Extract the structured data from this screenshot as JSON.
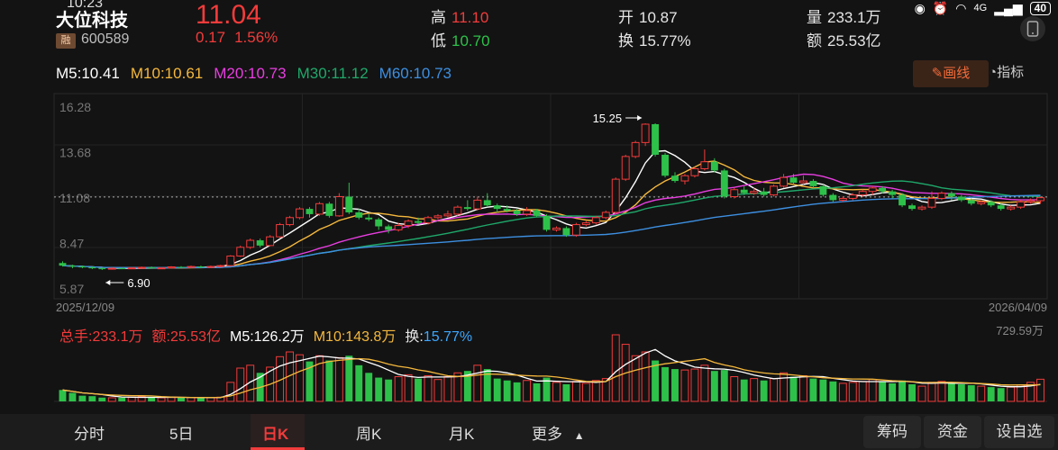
{
  "status": {
    "time": "10:23",
    "battery": "40",
    "network": "4G"
  },
  "stock": {
    "name": "大位科技",
    "tag": "融",
    "code": "600589",
    "price": "11.04",
    "change": "0.17",
    "change_pct": "1.56%"
  },
  "quote": {
    "high_label": "高",
    "high": "11.10",
    "low_label": "低",
    "low": "10.70",
    "open_label": "开",
    "open": "10.87",
    "turnover_label": "换",
    "turnover": "15.77%",
    "volume_label": "量",
    "volume": "233.1万",
    "amount_label": "额",
    "amount": "25.53亿"
  },
  "ma": {
    "m5": "M5:10.41",
    "m10": "M10:10.61",
    "m20": "M20:10.73",
    "m30": "M30:11.12",
    "m60": "M60:10.73",
    "colors": {
      "m5": "#ffffff",
      "m10": "#f5b83d",
      "m20": "#e83ee0",
      "m30": "#1fa86a",
      "m60": "#3d8fe0"
    }
  },
  "toolbar": {
    "draw_label": "画线",
    "indicator_label": "指标"
  },
  "chart_data": {
    "type": "candlestick",
    "y_ticks": [
      "16.28",
      "13.68",
      "11.08",
      "8.47",
      "5.87"
    ],
    "ylim": [
      5.87,
      16.28
    ],
    "start_date": "2025/12/09",
    "end_date": "2026/04/09",
    "max_label": "15.25",
    "min_label": "6.90",
    "current_price": 11.08,
    "candles": [
      [
        7.3,
        7.15,
        7.4,
        7.1
      ],
      [
        7.15,
        7.1,
        7.2,
        7.0
      ],
      [
        7.1,
        7.05,
        7.15,
        7.0
      ],
      [
        7.05,
        7.0,
        7.1,
        6.95
      ],
      [
        7.0,
        6.95,
        7.05,
        6.9
      ],
      [
        6.95,
        7.0,
        7.05,
        6.92
      ],
      [
        7.0,
        6.98,
        7.05,
        6.95
      ],
      [
        6.98,
        7.02,
        7.05,
        6.95
      ],
      [
        7.02,
        7.05,
        7.1,
        7.0
      ],
      [
        7.05,
        7.0,
        7.1,
        6.98
      ],
      [
        7.0,
        7.02,
        7.05,
        6.98
      ],
      [
        7.02,
        7.08,
        7.12,
        7.0
      ],
      [
        7.08,
        7.05,
        7.12,
        7.02
      ],
      [
        7.05,
        7.1,
        7.15,
        7.02
      ],
      [
        7.1,
        7.05,
        7.15,
        7.02
      ],
      [
        7.05,
        7.1,
        7.15,
        7.02
      ],
      [
        7.1,
        7.15,
        7.2,
        7.05
      ],
      [
        7.15,
        7.7,
        7.75,
        7.1
      ],
      [
        7.7,
        8.2,
        8.3,
        7.65
      ],
      [
        8.2,
        8.6,
        8.7,
        8.1
      ],
      [
        8.6,
        8.3,
        8.7,
        8.2
      ],
      [
        8.3,
        8.8,
        8.9,
        8.25
      ],
      [
        8.8,
        9.5,
        9.6,
        8.7
      ],
      [
        9.5,
        9.9,
        10.0,
        9.4
      ],
      [
        9.9,
        10.4,
        10.5,
        9.8
      ],
      [
        10.4,
        10.1,
        10.5,
        9.9
      ],
      [
        10.1,
        10.7,
        10.8,
        10.0
      ],
      [
        10.7,
        10.0,
        10.8,
        9.9
      ],
      [
        10.0,
        11.1,
        11.3,
        9.95
      ],
      [
        11.1,
        10.2,
        11.9,
        10.1
      ],
      [
        10.2,
        9.9,
        10.4,
        9.8
      ],
      [
        9.9,
        9.8,
        10.1,
        9.7
      ],
      [
        9.8,
        9.4,
        9.9,
        9.2
      ],
      [
        9.4,
        9.2,
        9.5,
        9.0
      ],
      [
        9.2,
        9.45,
        9.6,
        9.1
      ],
      [
        9.45,
        9.7,
        9.8,
        9.3
      ],
      [
        9.7,
        9.6,
        9.9,
        9.5
      ],
      [
        9.6,
        9.9,
        10.0,
        9.5
      ],
      [
        9.9,
        10.0,
        10.1,
        9.8
      ],
      [
        10.0,
        10.1,
        10.3,
        9.9
      ],
      [
        10.1,
        10.5,
        10.6,
        10.0
      ],
      [
        10.5,
        10.4,
        10.9,
        10.3
      ],
      [
        10.4,
        10.9,
        11.1,
        10.3
      ],
      [
        10.9,
        10.6,
        11.3,
        10.5
      ],
      [
        10.6,
        10.4,
        10.7,
        10.2
      ],
      [
        10.4,
        10.3,
        10.6,
        10.2
      ],
      [
        10.3,
        10.1,
        10.4,
        10.0
      ],
      [
        10.1,
        10.3,
        10.5,
        10.0
      ],
      [
        10.3,
        10.0,
        10.4,
        9.95
      ],
      [
        10.0,
        9.2,
        10.1,
        9.1
      ],
      [
        9.2,
        9.3,
        9.4,
        9.1
      ],
      [
        9.3,
        8.9,
        9.4,
        8.8
      ],
      [
        8.9,
        9.5,
        9.6,
        8.8
      ],
      [
        9.5,
        9.6,
        9.7,
        9.4
      ],
      [
        9.6,
        9.9,
        10.0,
        9.5
      ],
      [
        9.9,
        10.2,
        10.3,
        9.8
      ],
      [
        10.2,
        12.1,
        12.2,
        10.1
      ],
      [
        12.1,
        13.4,
        13.5,
        12.0
      ],
      [
        13.4,
        14.2,
        14.3,
        13.3
      ],
      [
        14.2,
        15.25,
        15.3,
        14.0
      ],
      [
        15.25,
        13.5,
        15.3,
        13.4
      ],
      [
        13.5,
        12.3,
        13.6,
        12.2
      ],
      [
        12.3,
        12.0,
        12.5,
        11.9
      ],
      [
        12.0,
        12.3,
        12.4,
        11.8
      ],
      [
        12.3,
        12.7,
        12.8,
        12.2
      ],
      [
        12.7,
        13.1,
        13.8,
        12.6
      ],
      [
        13.1,
        12.6,
        13.3,
        12.5
      ],
      [
        12.6,
        11.1,
        12.7,
        11.0
      ],
      [
        11.1,
        11.5,
        11.6,
        11.0
      ],
      [
        11.5,
        11.3,
        11.7,
        11.2
      ],
      [
        11.3,
        11.4,
        11.6,
        11.2
      ],
      [
        11.4,
        11.2,
        11.6,
        11.1
      ],
      [
        11.2,
        11.7,
        11.8,
        11.1
      ],
      [
        11.7,
        12.2,
        12.4,
        11.6
      ],
      [
        12.2,
        11.9,
        12.4,
        11.8
      ],
      [
        11.9,
        12.0,
        12.3,
        11.8
      ],
      [
        12.0,
        11.7,
        12.1,
        11.6
      ],
      [
        11.7,
        11.2,
        11.8,
        11.1
      ],
      [
        11.2,
        10.9,
        11.3,
        10.8
      ],
      [
        10.9,
        11.0,
        11.1,
        10.8
      ],
      [
        11.0,
        11.2,
        11.3,
        10.9
      ],
      [
        11.2,
        11.4,
        11.5,
        11.1
      ],
      [
        11.4,
        11.6,
        11.7,
        11.2
      ],
      [
        11.6,
        11.4,
        11.7,
        11.3
      ],
      [
        11.4,
        11.2,
        11.5,
        11.0
      ],
      [
        11.2,
        10.6,
        11.3,
        10.5
      ],
      [
        10.6,
        10.4,
        10.7,
        10.3
      ],
      [
        10.4,
        10.5,
        10.6,
        10.3
      ],
      [
        10.5,
        11.0,
        11.4,
        10.4
      ],
      [
        11.0,
        11.3,
        11.4,
        10.9
      ],
      [
        11.3,
        11.1,
        11.4,
        10.9
      ],
      [
        11.1,
        10.9,
        11.2,
        10.8
      ],
      [
        10.9,
        10.7,
        11.0,
        10.6
      ],
      [
        10.7,
        10.8,
        10.9,
        10.6
      ],
      [
        10.8,
        10.6,
        10.9,
        10.5
      ],
      [
        10.6,
        10.4,
        10.7,
        10.3
      ],
      [
        10.4,
        10.5,
        10.6,
        10.3
      ],
      [
        10.5,
        10.8,
        10.9,
        10.4
      ],
      [
        10.8,
        10.87,
        11.0,
        10.7
      ],
      [
        10.87,
        11.04,
        11.1,
        10.7
      ]
    ],
    "volume_max_label": "729.59万",
    "volumes": [
      120,
      90,
      60,
      55,
      40,
      38,
      40,
      45,
      50,
      42,
      38,
      45,
      40,
      42,
      38,
      40,
      45,
      200,
      350,
      380,
      300,
      360,
      470,
      520,
      490,
      420,
      480,
      430,
      460,
      480,
      380,
      300,
      250,
      230,
      260,
      280,
      240,
      270,
      230,
      260,
      300,
      320,
      380,
      340,
      240,
      220,
      200,
      220,
      190,
      250,
      200,
      180,
      210,
      190,
      220,
      240,
      700,
      600,
      480,
      520,
      430,
      360,
      340,
      330,
      340,
      380,
      320,
      330,
      260,
      230,
      240,
      220,
      240,
      300,
      260,
      270,
      240,
      230,
      210,
      190,
      200,
      210,
      230,
      210,
      190,
      220,
      180,
      160,
      200,
      210,
      200,
      180,
      170,
      160,
      150,
      140,
      150,
      170,
      200,
      233
    ],
    "volume_legend": {
      "total": "总手:233.1万",
      "amount": "额:25.53亿",
      "m5": "M5:126.2万",
      "m10": "M10:143.8万",
      "turnover_label": "换:",
      "turnover": "15.77%"
    }
  },
  "tabs": [
    {
      "label": "分时"
    },
    {
      "label": "5日"
    },
    {
      "label": "日K"
    },
    {
      "label": "周K"
    },
    {
      "label": "月K"
    },
    {
      "label": "更多"
    }
  ],
  "actions": {
    "chips": "筹码",
    "funds": "资金",
    "settings": "设自选"
  }
}
